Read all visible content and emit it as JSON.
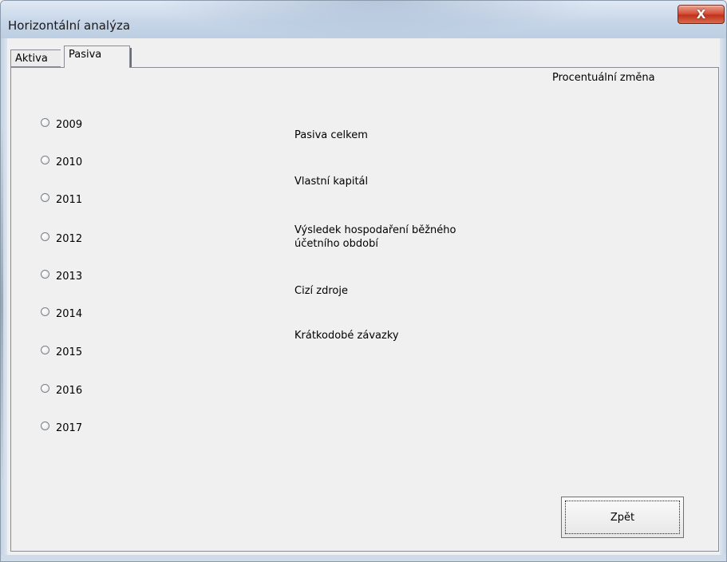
{
  "window": {
    "title": "Horizontální analýza",
    "close_symbol": "X"
  },
  "tabs": [
    {
      "label": "Aktiva",
      "selected": false
    },
    {
      "label": "Pasiva",
      "selected": true
    }
  ],
  "panel": {
    "column_header": "Procentuální změna",
    "years": [
      "2009",
      "2010",
      "2011",
      "2012",
      "2013",
      "2014",
      "2015",
      "2016",
      "2017"
    ],
    "items": [
      "Pasiva celkem",
      "Vlastní kapitál",
      "Výsledek hospodaření běžného účetního období",
      "Cizí zdroje",
      "Krátkodobé závazky"
    ],
    "back_button": "Zpět"
  },
  "icons": {
    "close": "close-icon"
  },
  "colors": {
    "close_button": "#c8432d",
    "background": "#f0f0f0"
  }
}
